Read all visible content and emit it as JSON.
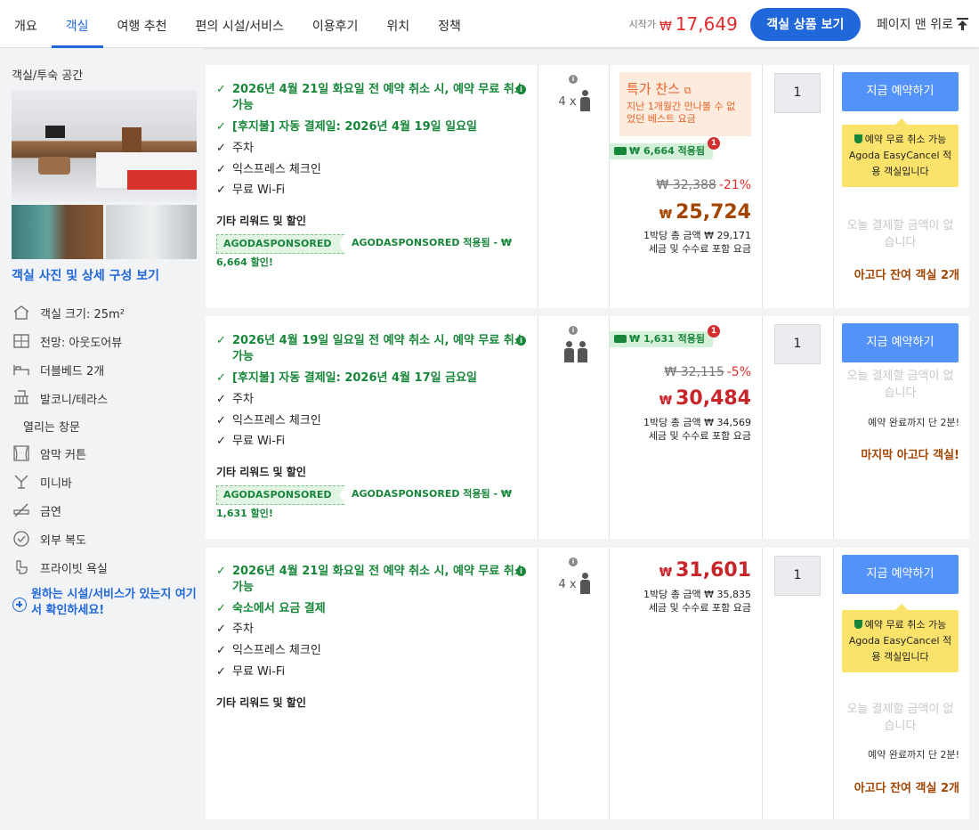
{
  "nav": {
    "tabs": [
      "개요",
      "객실",
      "여행 추천",
      "편의 시설/서비스",
      "이용후기",
      "위치",
      "정책"
    ],
    "active_index": 1,
    "from_label": "시작가",
    "currency": "₩",
    "from_price": "17,649",
    "view_button": "객실 상품 보기",
    "top_link": "페이지 맨 위로"
  },
  "room": {
    "title": "객실/투숙 공간",
    "photos_link": "객실 사진 및 상세 구성 보기",
    "amenities": [
      {
        "label": "객실 크기: 25m²",
        "icon": "room-size-icon"
      },
      {
        "label": "전망: 아웃도어뷰",
        "icon": "view-icon"
      },
      {
        "label": "더블베드 2개",
        "icon": "bed-icon"
      },
      {
        "label": "발코니/테라스",
        "icon": "balcony-icon"
      },
      {
        "label": "열리는 창문",
        "icon": ""
      },
      {
        "label": "암막 커튼",
        "icon": "curtain-icon"
      },
      {
        "label": "미니바",
        "icon": "minibar-icon"
      },
      {
        "label": "금연",
        "icon": "no-smoking-icon"
      },
      {
        "label": "외부 복도",
        "icon": "check-circle-icon"
      },
      {
        "label": "프라이빗 욕실",
        "icon": "bathroom-icon"
      }
    ],
    "ask_link": "원하는 시설/서비스가 있는지 여기서 확인하세요!"
  },
  "colors": {
    "accent": "#2067da",
    "green": "#17863a",
    "price_red": "#e12d2d",
    "brown": "#a34400",
    "tooltip": "#fbe36b"
  },
  "cards": [
    {
      "features": [
        {
          "text": "2026년 4월 21일 화요일 전 예약 취소 시, 예약 무료 취소 가능",
          "style": "green",
          "info": true
        },
        {
          "text": "[후지불] 자동 결제일: 2026년 4월 19일 일요일",
          "style": "green"
        },
        {
          "text": "주차",
          "style": "dark"
        },
        {
          "text": "익스프레스 체크인",
          "style": "dark"
        },
        {
          "text": "무료 Wi-Fi",
          "style": "dark"
        }
      ],
      "other_title": "기타 리워드 및 할인",
      "sponsor_tag": "AGODASPONSORED",
      "sponsor_text": "AGODASPONSORED 적용됨 - ₩ 6,664 할인!",
      "occupancy": "4 x",
      "deal_title": "특가 찬스",
      "deal_sub": "지난 1개월간 만나볼 수 없었던 베스트 요금",
      "coupon": "₩ 6,664 적용됨",
      "badge": "1",
      "old_price": "₩ 32,388",
      "discount": "-21%",
      "currency": "₩",
      "price": "25,724",
      "nightly_total": "1박당 총 금액 ₩ 29,171",
      "tax_note": "세금 및 수수료 포함 요금",
      "qty": "1",
      "book_label": "지금 예약하기",
      "tooltip_line1": "예약 무료 취소 가능",
      "tooltip_line2": "Agoda EasyCancel 적용 객실입니다",
      "pay_note": "오늘 결제할 금액이 없습니다",
      "rooms_left": "아고다 잔여 객실 2개"
    },
    {
      "features": [
        {
          "text": "2026년 4월 19일 일요일 전 예약 취소 시, 예약 무료 취소 가능",
          "style": "green",
          "info": true
        },
        {
          "text": "[후지불] 자동 결제일: 2026년 4월 17일 금요일",
          "style": "green"
        },
        {
          "text": "주차",
          "style": "dark"
        },
        {
          "text": "익스프레스 체크인",
          "style": "dark"
        },
        {
          "text": "무료 Wi-Fi",
          "style": "dark"
        }
      ],
      "other_title": "기타 리워드 및 할인",
      "sponsor_tag": "AGODASPONSORED",
      "sponsor_text": "AGODASPONSORED 적용됨 - ₩ 1,631 할인!",
      "coupon": "₩ 1,631 적용됨",
      "badge": "1",
      "old_price": "₩ 32,115",
      "discount": "-5%",
      "currency": "₩",
      "price": "30,484",
      "nightly_total": "1박당 총 금액 ₩ 34,569",
      "tax_note": "세금 및 수수료 포함 요금",
      "qty": "1",
      "book_label": "지금 예약하기",
      "pay_note": "오늘 결제할 금액이 없습니다",
      "soon_note": "예약 완료까지 단 2분!",
      "rooms_left": "마지막 아고다 객실!"
    },
    {
      "features": [
        {
          "text": "2026년 4월 21일 화요일 전 예약 취소 시, 예약 무료 취소 가능",
          "style": "green",
          "info": true
        },
        {
          "text": "숙소에서 요금 결제",
          "style": "green"
        },
        {
          "text": "주차",
          "style": "dark"
        },
        {
          "text": "익스프레스 체크인",
          "style": "dark"
        },
        {
          "text": "무료 Wi-Fi",
          "style": "dark"
        }
      ],
      "other_title": "기타 리워드 및 할인",
      "occupancy": "4 x",
      "currency": "₩",
      "price": "31,601",
      "nightly_total": "1박당 총 금액 ₩ 35,835",
      "tax_note": "세금 및 수수료 포함 요금",
      "qty": "1",
      "book_label": "지금 예약하기",
      "tooltip_line1": "예약 무료 취소 가능",
      "tooltip_line2": "Agoda EasyCancel 적용 객실입니다",
      "pay_note": "오늘 결제할 금액이 없습니다",
      "soon_note": "예약 완료까지 단 2분!",
      "rooms_left": "아고다 잔여 객실 2개"
    }
  ]
}
